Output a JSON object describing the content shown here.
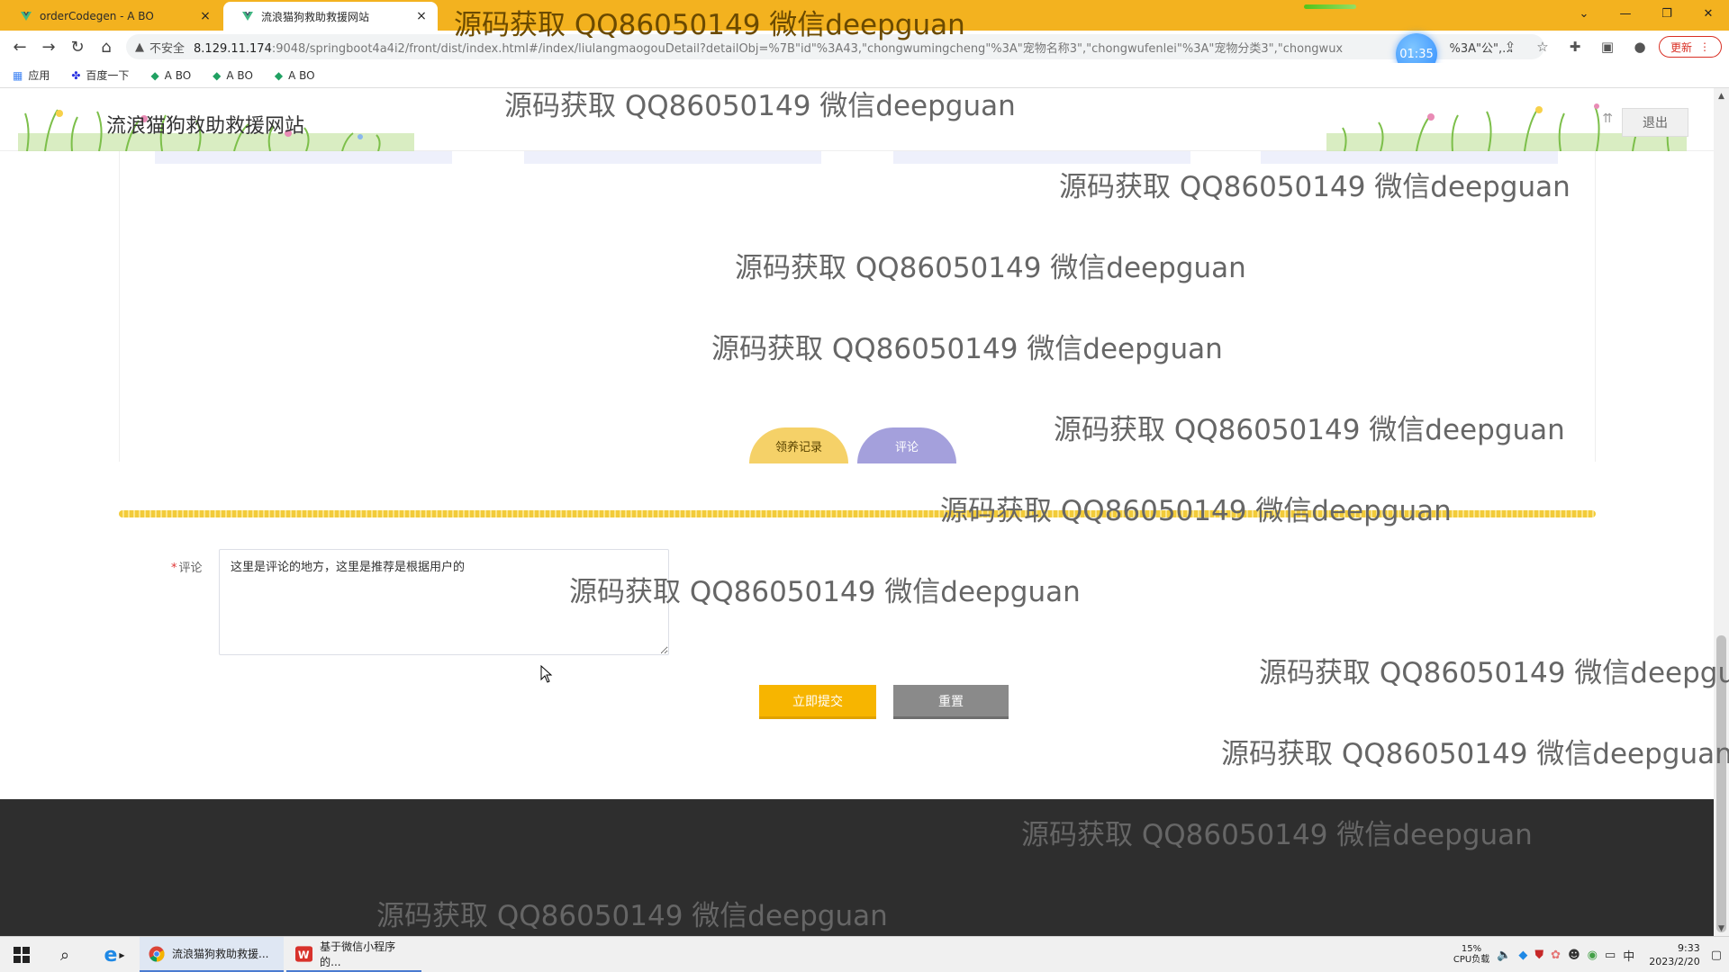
{
  "browser": {
    "tabs": [
      {
        "title": "orderCodegen - A BO",
        "active": false
      },
      {
        "title": "流浪猫狗救助救援网站",
        "active": true
      }
    ],
    "tab_close": "×",
    "timer": "01:35",
    "address": {
      "insecure_label": "不安全",
      "host": "8.129.11.174",
      "path": ":9048/springboot4a4i2/front/dist/index.html#/index/liulangmaogouDetail?detailObj=%7B\"id\"%3A43,\"chongwumingcheng\"%3A\"宠物名称3\",\"chongwufenlei\"%3A\"宠物分类3\",\"chongwux",
      "path_tail": "%3A\"公\",..."
    },
    "update_label": "更新",
    "bookmarks": [
      {
        "label": "应用",
        "icon": "apps-grid-icon"
      },
      {
        "label": "百度一下",
        "icon": "baidu-paw-icon"
      },
      {
        "label": "A BO",
        "icon": "leaf-icon"
      },
      {
        "label": "A BO",
        "icon": "leaf-icon"
      },
      {
        "label": "A BO",
        "icon": "leaf-icon"
      }
    ]
  },
  "site": {
    "title": "流浪猫狗救助救援网站",
    "logout_label": "退出",
    "tabs": {
      "adopt": "领养记录",
      "comment": "评论"
    },
    "form": {
      "required_mark": "*",
      "comment_label": "评论",
      "comment_value": "这里是评论的地方，这里是推荐是根据用户的",
      "submit_label": "立即提交",
      "reset_label": "重置"
    }
  },
  "watermark_text": "源码获取 QQ86050149 微信deepguan",
  "taskbar": {
    "apps": [
      {
        "label": "流浪猫狗救助救援...",
        "icon": "chrome-icon"
      },
      {
        "label": "基于微信小程序的...",
        "icon": "wps-icon"
      }
    ],
    "cpu_percent": "15%",
    "cpu_label": "CPU负载",
    "ime": "中",
    "time": "9:33",
    "date": "2023/2/20"
  },
  "colors": {
    "tabstrip": "#f3b21f",
    "submit": "#f7b500",
    "reset": "#8a8a8a",
    "adopt_tab": "#f5d168",
    "comment_tab": "#a4a0dc",
    "footer": "#2e2e2e"
  }
}
